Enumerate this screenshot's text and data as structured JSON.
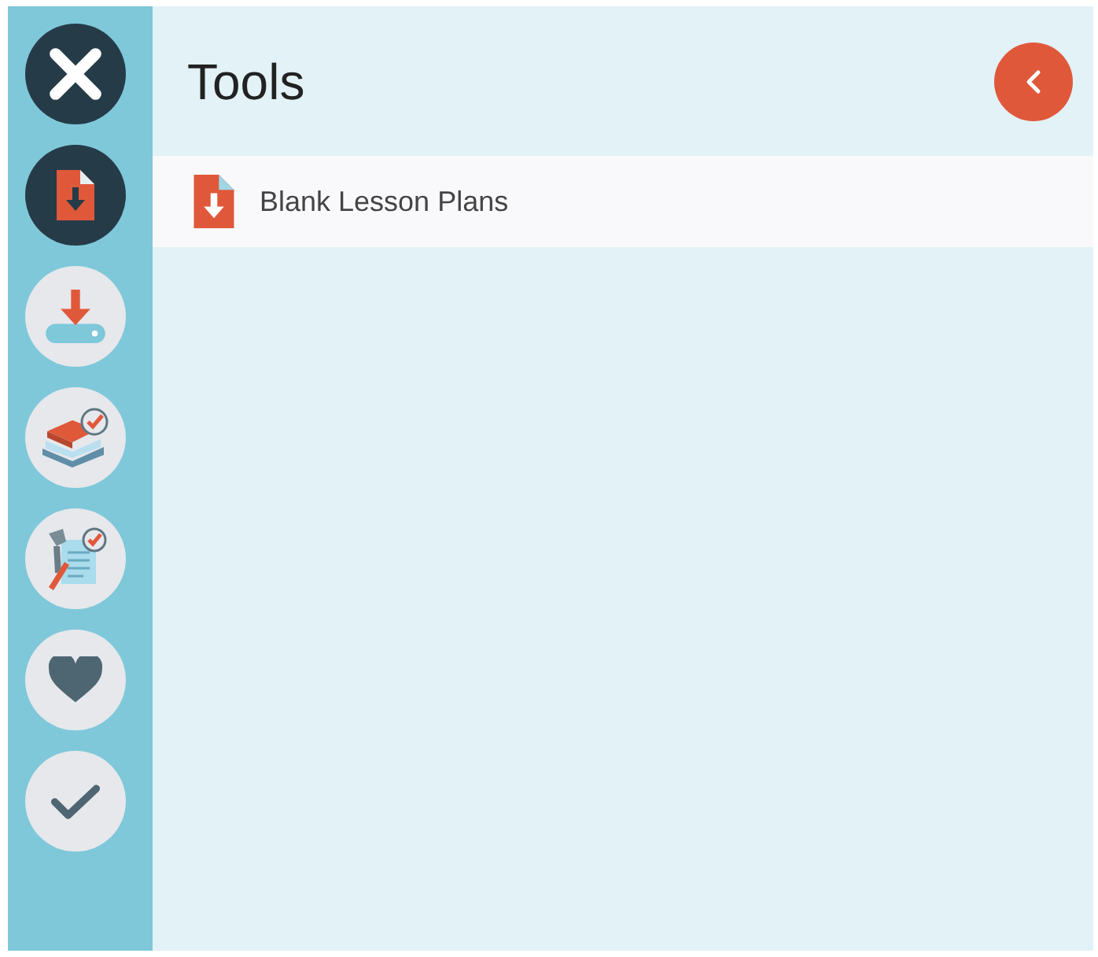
{
  "sidebar": {
    "items": [
      {
        "kind": "document-download",
        "selected": true
      },
      {
        "kind": "download",
        "selected": false
      },
      {
        "kind": "books",
        "selected": false
      },
      {
        "kind": "checklist",
        "selected": false
      },
      {
        "kind": "heart",
        "selected": false
      },
      {
        "kind": "check",
        "selected": false
      }
    ]
  },
  "panel": {
    "title": "Tools",
    "items": [
      {
        "label": "Blank Lesson Plans"
      }
    ]
  }
}
